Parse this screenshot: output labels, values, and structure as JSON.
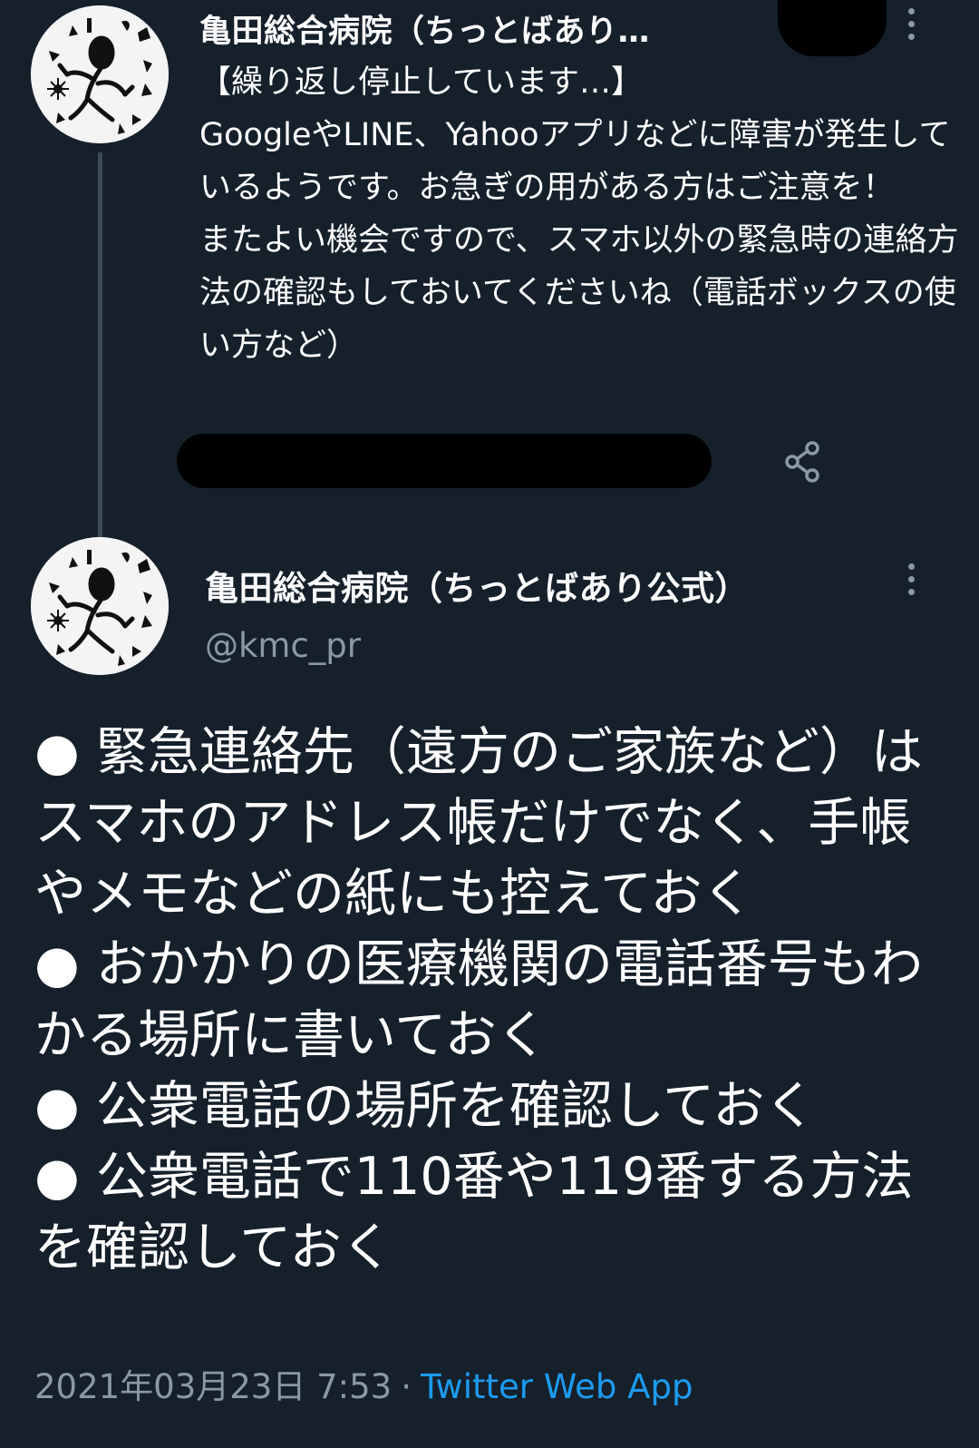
{
  "tweet1": {
    "display_name": "亀田総合病院（ちっとばあり…",
    "text": "【繰り返し停止しています…】\nGoogleやLINE、Yahooアプリなどに障害が発生しているようです。お急ぎの用がある方はご注意を！\nまたよい機会ですので、スマホ以外の緊急時の連絡方法の確認もしておいてくださいね（電話ボックスの使い方など）",
    "avatar_icon": "tribal-figure-avatar",
    "actions": {
      "share_icon": "share-icon",
      "more_icon": "more-vertical-icon"
    }
  },
  "tweet2": {
    "display_name": "亀田総合病院（ちっとばあり公式）",
    "handle": "@kmc_pr",
    "text": "● 緊急連絡先（遠方のご家族など）はスマホのアドレス帳だけでなく、手帳やメモなどの紙にも控えておく\n● おかかりの医療機関の電話番号もわかる場所に書いておく\n● 公衆電話の場所を確認しておく\n● 公衆電話で110番や119番する方法を確認しておく",
    "date": "2021年03月23日 7:53",
    "separator": "·",
    "source": "Twitter Web App"
  },
  "colors": {
    "background": "#15202b",
    "text": "#ffffff",
    "secondary_text": "#8b98a5",
    "link": "#1d9bf0",
    "thread_line": "#3d4a56"
  }
}
